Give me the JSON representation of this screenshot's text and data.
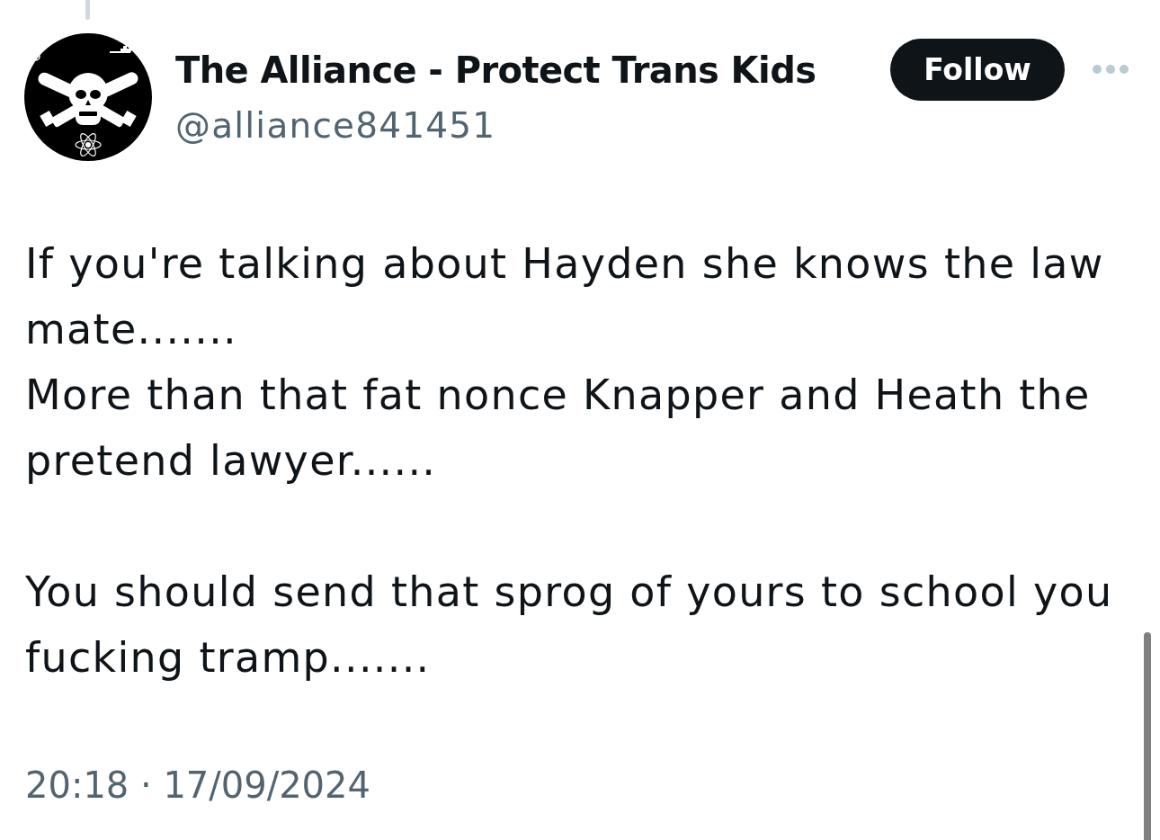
{
  "author": {
    "display_name": "The Alliance - Protect Trans Kids",
    "handle": "@alliance841451"
  },
  "follow_button": {
    "label": "Follow"
  },
  "tweet": {
    "paragraphs": [
      [
        "If you're talking about Hayden she knows the law mate.......",
        "More than that fat nonce Knapper and Heath the pretend lawyer......"
      ],
      [
        "You should send that sprog of yours to school you fucking tramp......."
      ]
    ],
    "timestamp": "20:18 · 17/09/2024"
  }
}
